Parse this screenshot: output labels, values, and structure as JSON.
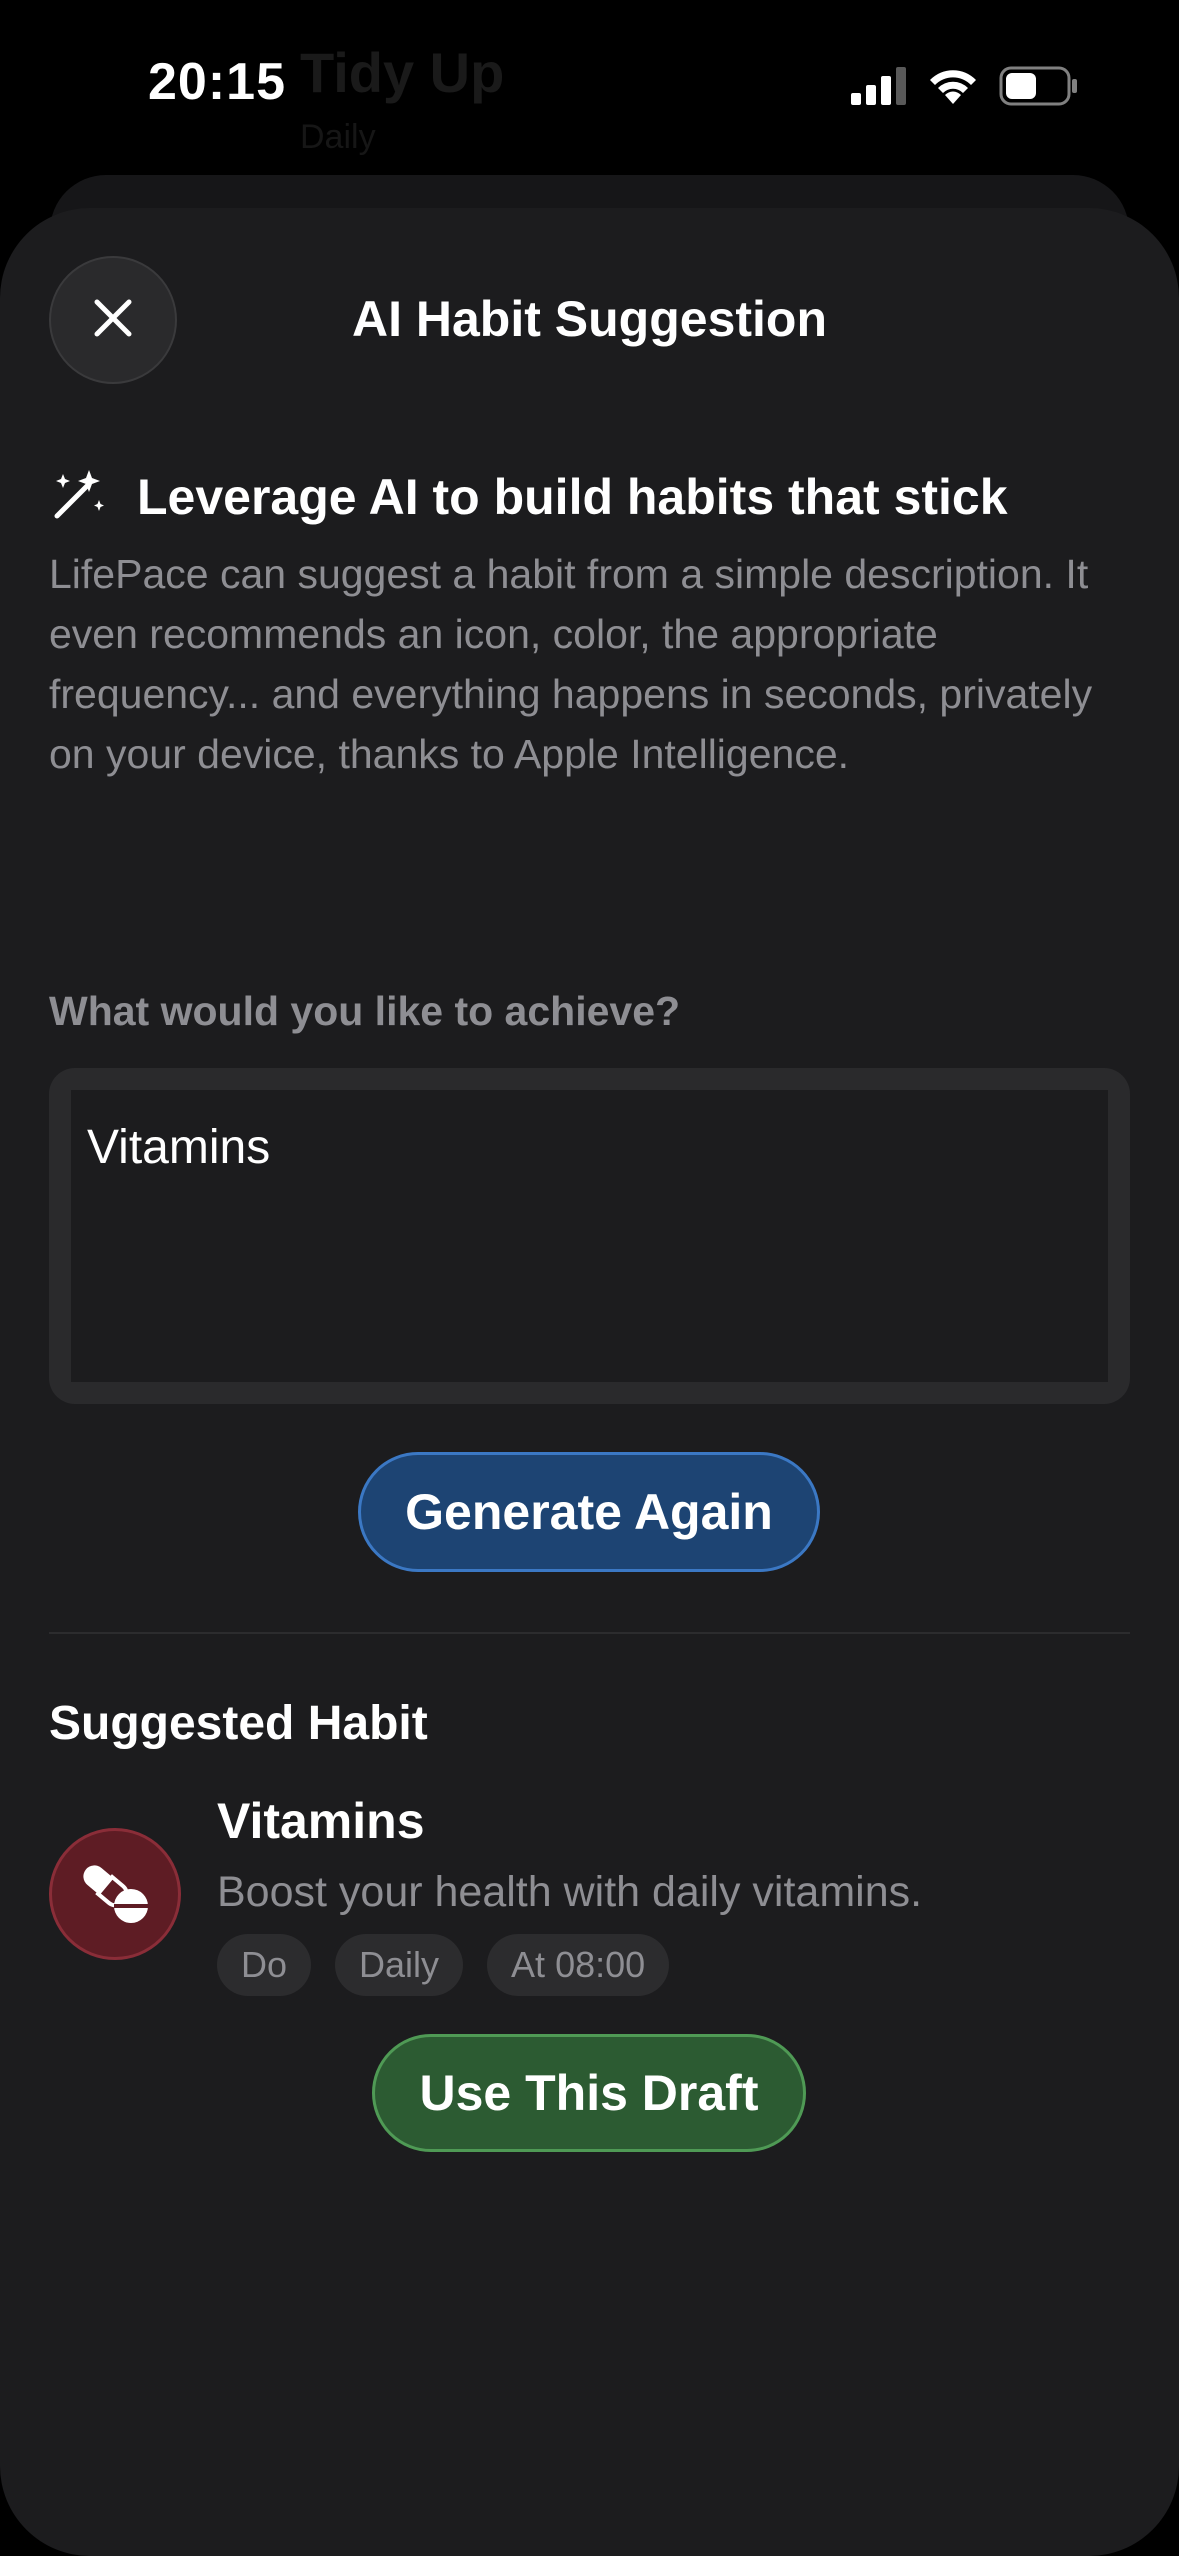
{
  "status_bar": {
    "time": "20:15"
  },
  "background_app": {
    "title": "Tidy Up",
    "subtitle": "Daily"
  },
  "sheet": {
    "title": "AI Habit Suggestion",
    "intro": {
      "icon": "magic-wand-icon",
      "heading": "Leverage AI to build habits that stick",
      "body": "LifePace can suggest a habit from a simple description. It even recommends an icon, color, the appropriate frequency... and everything happens in seconds, privately on your device, thanks to Apple Intelligence."
    },
    "prompt": {
      "label": "What would you like to achieve?",
      "value": "Vitamins"
    },
    "generate_button": "Generate Again",
    "suggested": {
      "label": "Suggested Habit",
      "icon": "pills-icon",
      "icon_color": "#5e1c24",
      "name": "Vitamins",
      "description": "Boost your health with daily vitamins.",
      "tags": [
        "Do",
        "Daily",
        "At 08:00"
      ]
    },
    "use_button": "Use This Draft"
  },
  "colors": {
    "sheet_bg": "#1c1c1e",
    "accent_blue": "#1d4473",
    "accent_green": "#2c5b32",
    "secondary_text": "#8e8e93"
  }
}
